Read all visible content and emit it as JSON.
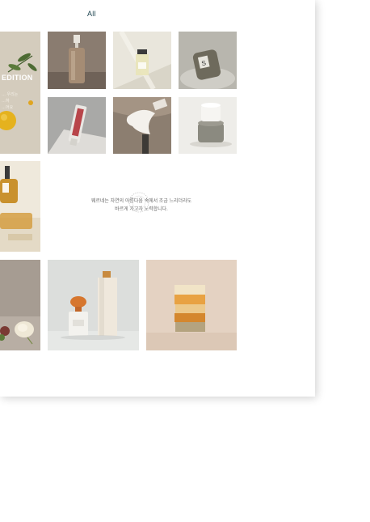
{
  "gallery": {
    "filter_label": "All",
    "edition_title": "EDITION",
    "edition_sub_1": "… 우리는",
    "edition_sub_2": "…하",
    "edition_sub_3": "…어요",
    "tagline_line1": "웨르네는 자연의 아름다움 속에서 조금 느리더라도",
    "tagline_line2": "바르게 가고자 노력합니다."
  },
  "colors": {
    "accent": "#1d4450",
    "text_muted": "#6b6b6b",
    "card_bg": "#ffffff"
  }
}
